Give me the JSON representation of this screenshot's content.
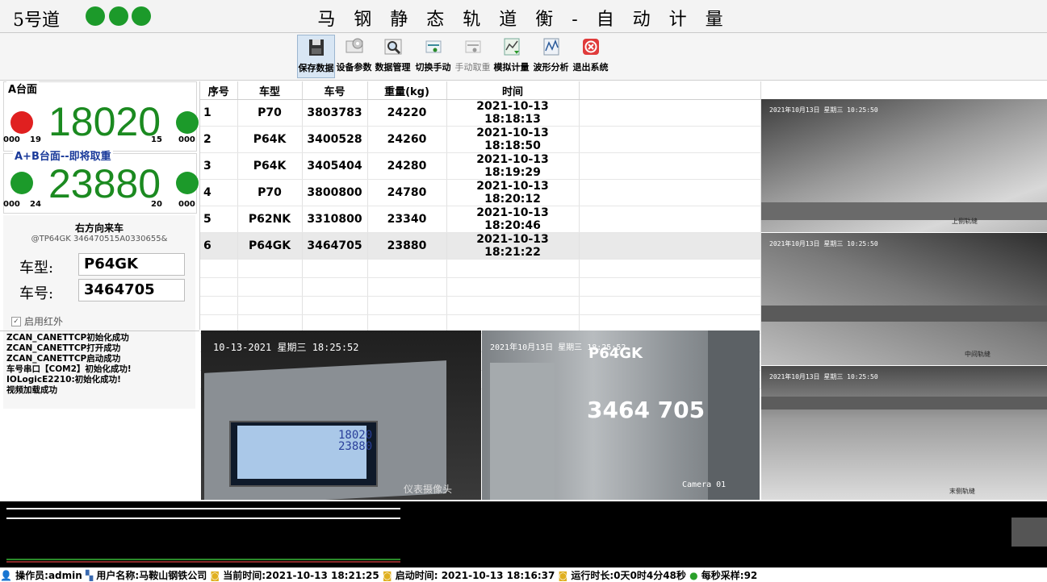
{
  "title_bar": {
    "line_name": "5号道",
    "title": "马 钢 静 态 轨 道 衡 - 自 动 计 量",
    "lamp_color": "#1c9a2a"
  },
  "toolbar": {
    "buttons": [
      {
        "label": "保存数据",
        "icon": "save-disk-icon",
        "active": true
      },
      {
        "label": "设备参数",
        "icon": "device-settings-icon"
      },
      {
        "label": "数据管理",
        "icon": "magnifier-data-icon"
      },
      {
        "label": "切换手动",
        "icon": "switch-manual-icon"
      },
      {
        "label": "手动取重",
        "icon": "manual-weigh-icon",
        "disabled": true
      },
      {
        "label": "模拟计量",
        "icon": "simulate-chart-icon"
      },
      {
        "label": "波形分析",
        "icon": "waveform-chart-icon"
      },
      {
        "label": "退出系统",
        "icon": "exit-close-icon"
      }
    ]
  },
  "platform_a": {
    "label": "A台面",
    "weight": "18020",
    "left_code": "000",
    "left_sub": "19",
    "right_sub": "15",
    "right_code": "000",
    "left_lamp": "#e02020",
    "right_lamp": "#1c9a2a"
  },
  "platform_ab": {
    "label": "A+B台面--即将取重",
    "weight": "23880",
    "left_code": "000",
    "left_sub": "24",
    "right_sub": "20",
    "right_code": "000",
    "left_lamp": "#1c9a2a",
    "right_lamp": "#1c9a2a"
  },
  "direction": {
    "text": "右方向来车",
    "raw": "@TP64GK 346470515A0330655&"
  },
  "car": {
    "type_label": "车型:",
    "type_value": "P64GK",
    "number_label": "车号:",
    "number_value": "3464705"
  },
  "infrared": {
    "label": "启用红外",
    "checked": true
  },
  "log": [
    "ZCAN_CANETTCP初始化成功",
    "ZCAN_CANETTCP打开成功",
    "ZCAN_CANETTCP启动成功",
    "车号串口【COM2】初始化成功!",
    "IOLogicE2210:初始化成功!",
    "视频加载成功"
  ],
  "table": {
    "headers": [
      "序号",
      "车型",
      "车号",
      "重量(kg)",
      "时间"
    ],
    "rows": [
      [
        "1",
        "P70",
        "3803783",
        "24220",
        "2021-10-13 18:18:13"
      ],
      [
        "2",
        "P64K",
        "3400528",
        "24260",
        "2021-10-13 18:18:50"
      ],
      [
        "3",
        "P64K",
        "3405404",
        "24280",
        "2021-10-13 18:19:29"
      ],
      [
        "4",
        "P70",
        "3800800",
        "24780",
        "2021-10-13 18:20:12"
      ],
      [
        "5",
        "P62NK",
        "3310800",
        "23340",
        "2021-10-13 18:20:46"
      ],
      [
        "6",
        "P64GK",
        "3464705",
        "23880",
        "2021-10-13 18:21:22"
      ]
    ],
    "selected_row": 6
  },
  "cameras": {
    "meter_cam": {
      "timestamp": "10-13-2021 星期三 18:25:52",
      "caption": "仪表摄像头",
      "display_line1": "18020",
      "display_line2": "23880"
    },
    "car_cam": {
      "timestamp": "2021年10月13日 星期三 18:25:52",
      "plate_type": "P64GK",
      "plate_number": "3464 705",
      "camera_label": "Camera 01"
    },
    "rail_cam1": {
      "timestamp": "2021年10月13日 星期三 10:25:50",
      "caption": "上侧轨缝"
    },
    "rail_cam2": {
      "timestamp": "2021年10月13日 星期三 10:25:50"
    },
    "rail_cam3": {
      "caption": "中间轨缝"
    },
    "rail_cam4": {
      "timestamp": "2021年10月13日 星期三 10:25:50",
      "caption": "末侧轨缝"
    }
  },
  "status_bar": {
    "operator": "操作员:admin",
    "company": "用户名称:马鞍山钢铁公司",
    "current_time": "当前时间:2021-10-13 18:21:25",
    "start_time": "启动时间: 2021-10-13 18:16:37",
    "run_time": "运行时长:0天0时4分48秒",
    "samples": "每秒采样:92"
  }
}
